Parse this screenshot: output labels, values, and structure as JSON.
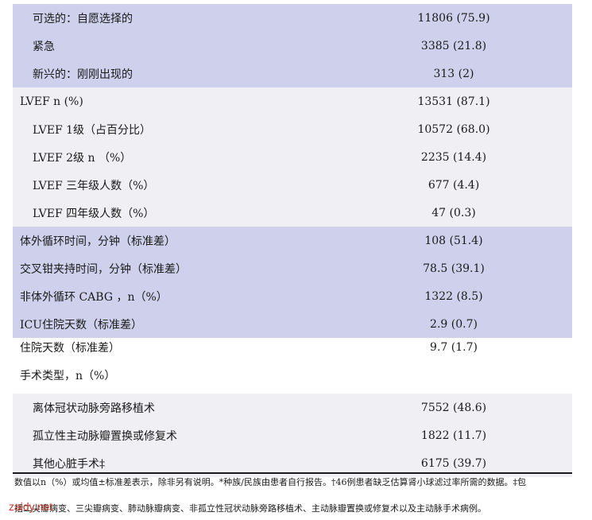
{
  "rows": [
    {
      "label": "可选的：自愿选择的",
      "value": "11806 (75.9)",
      "bg": "purple",
      "indent": 1
    },
    {
      "label": "紧急",
      "value": "3385 (21.8)",
      "bg": "purple",
      "indent": 1
    },
    {
      "label": "新兴的：刚刚出现的",
      "value": "313 (2)",
      "bg": "purple",
      "indent": 1
    },
    {
      "label": "LVEF n (%)",
      "value": "13531 (87.1)",
      "bg": "grey",
      "indent": 0
    },
    {
      "label": "LVEF 1级（占百分比）",
      "value": "10572 (68.0)",
      "bg": "grey",
      "indent": 1
    },
    {
      "label": "LVEF 2级 n （%）",
      "value": "2235 (14.4)",
      "bg": "grey",
      "indent": 1
    },
    {
      "label": "LVEF 三年级人数（%）",
      "value": "677 (4.4)",
      "bg": "grey",
      "indent": 1
    },
    {
      "label": "LVEF 四年级人数（%）",
      "value": "47 (0.3)",
      "bg": "grey",
      "indent": 1
    },
    {
      "label": "体外循环时间，分钟（标准差）",
      "value": "108 (51.4)",
      "bg": "purple",
      "indent": 0
    },
    {
      "label": "交叉钳夹持时间，分钟（标准差）",
      "value": "78.5 (39.1)",
      "bg": "purple",
      "indent": 0
    },
    {
      "label": "非体外循环 CABG ，n（%）",
      "value": "1322 (8.5)",
      "bg": "purple",
      "indent": 0
    },
    {
      "label": "ICU住院天数（标准差）",
      "value": "2.9 (0.7)",
      "bg": "purple",
      "indent": 0
    },
    {
      "label": "住院天数（标准差）",
      "value": "9.7 (1.7)",
      "bg": "white",
      "indent": 0
    },
    {
      "label": "手术类型，n（%）",
      "value": "",
      "bg": "white",
      "indent": 0
    },
    {
      "label": "离体冠状动脉旁路移植术",
      "value": "7552 (48.6)",
      "bg": "grey",
      "indent": 1
    },
    {
      "label": "孤立性主动脉瓣置换或修复术",
      "value": "1822 (11.7)",
      "bg": "grey",
      "indent": 1
    },
    {
      "label": "其他心脏手术‡",
      "value": "6175 (39.7)",
      "bg": "grey",
      "indent": 1
    }
  ],
  "footnote": {
    "line1": "数值以n（%）或均值±标准差表示，除非另有说明。*种族/民族由患者自行报告。†46例患者缺乏估算肾小球滤过率所需的数据。‡包",
    "line2": "括二尖瓣病变、三尖瓣病变、肺动脉瓣病变、非孤立性冠状动脉旁路移植术、主动脉瓣置换或修复术以及主动脉手术病例。"
  },
  "watermark": "zaidy.net"
}
